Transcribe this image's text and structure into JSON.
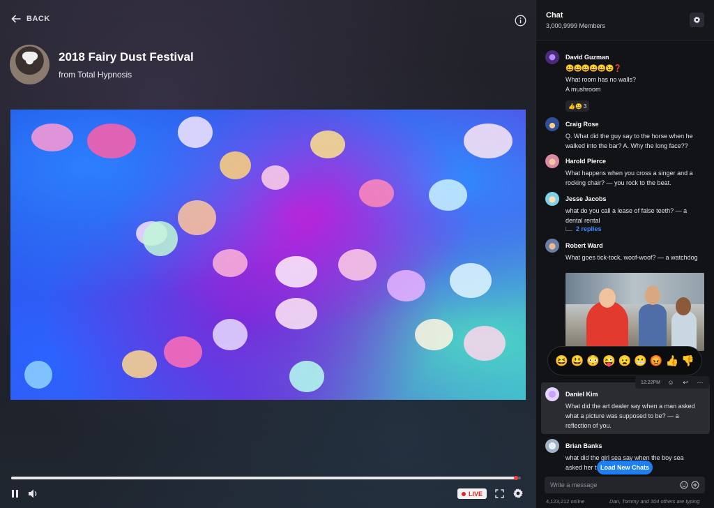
{
  "nav": {
    "back_label": "BACK"
  },
  "stream": {
    "title": "2018 Fairy Dust Festival",
    "subtitle": "from Total Hypnosis",
    "progress_percent": 99,
    "live_label": "LIVE"
  },
  "chat": {
    "title": "Chat",
    "members": "3,000,9999 Members",
    "messages": [
      {
        "name": "David Guzman",
        "emoji_line": "😀😀😀😀😀😉❓",
        "lines": [
          "What room has no walls?",
          "A mushroom"
        ],
        "reaction": "👍😀",
        "reaction_count": "3"
      },
      {
        "name": "Craig Rose",
        "text": "Q. What did the guy say to the horse when he walked into the bar? A. Why the long face??"
      },
      {
        "name": "Harold Pierce",
        "text": "What happens when you cross a singer and a rocking chair? — you rock to the beat."
      },
      {
        "name": "Jesse Jacobs",
        "text": "what do you call a lease of false teeth? — a dental rental",
        "replies": "2 replies"
      },
      {
        "name": "Robert Ward",
        "text": "What goes tick-tock, woof-woof? — a watchdog"
      },
      {
        "name": "Daniel Kim",
        "text": "What did the art dealer say when a man asked what a picture was supposed to be? — a reflection of you.",
        "time": "12:22PM"
      },
      {
        "name": "Brian Banks",
        "text": "what did the girl sea say when the boy sea asked her t"
      }
    ],
    "emoji_reactions": [
      "😆",
      "😃",
      "😳",
      "😜",
      "😦",
      "😬",
      "😡",
      "👍",
      "👎"
    ],
    "load_new_label": "Load New Chats",
    "input_placeholder": "Write a message",
    "online": "4,123,212 online",
    "typing": "Dan, Tommy and 304 others are typing"
  }
}
